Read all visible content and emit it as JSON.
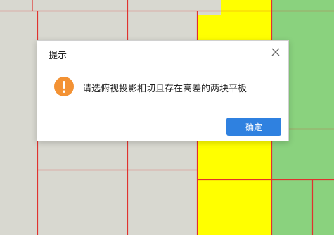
{
  "colors": {
    "background": "#d8d8d0",
    "yellow_block": "#ffff00",
    "green_block": "#8ad27e",
    "grid_line": "#e0322e",
    "warning": "#f39234",
    "accent": "#2f81e0"
  },
  "dialog": {
    "title": "提示",
    "message": "请选俯视投影相切且存在高差的两块平板",
    "ok_label": "确定",
    "icon": "warning-icon",
    "close_icon": "close-icon"
  }
}
